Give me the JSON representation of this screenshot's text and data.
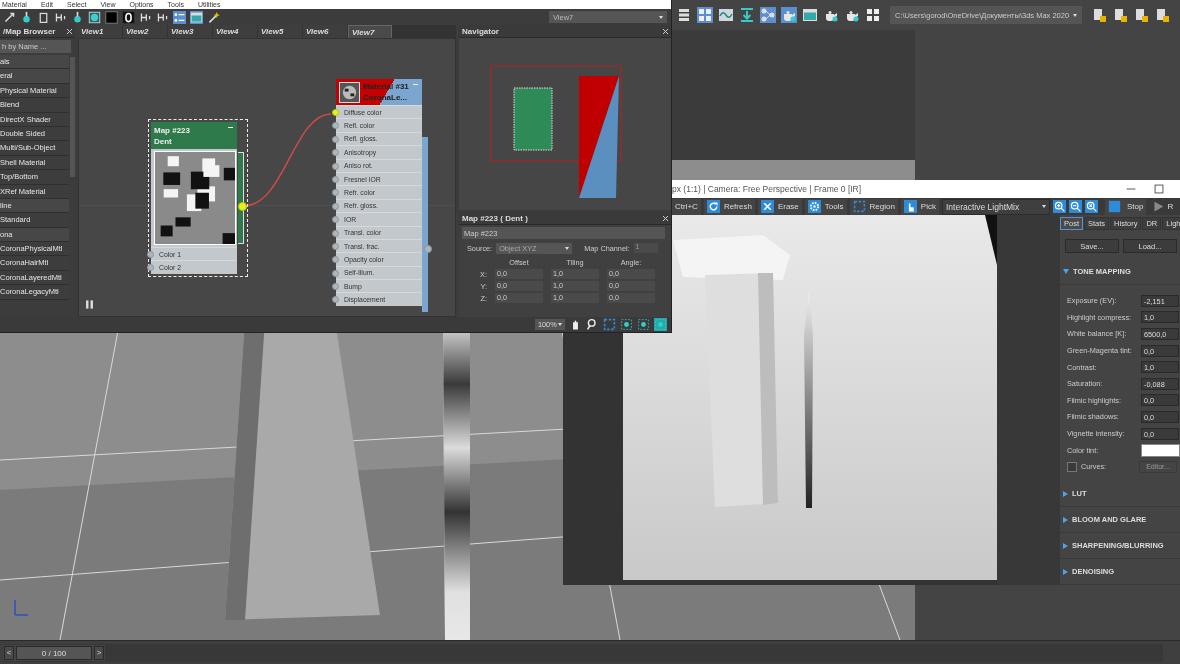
{
  "slate_editor": {
    "menu": [
      "Material",
      "Edit",
      "Select",
      "View",
      "Options",
      "Tools",
      "Utilities"
    ],
    "view_selector": "View7",
    "browser": {
      "title": "/Map Browser",
      "search_placeholder": "h by Name ...",
      "items": [
        {
          "kind": "group",
          "label": "als"
        },
        {
          "kind": "group",
          "label": "eral"
        },
        {
          "kind": "item",
          "label": "Physical Material"
        },
        {
          "kind": "item",
          "label": "Blend"
        },
        {
          "kind": "item",
          "label": "DirectX Shader"
        },
        {
          "kind": "item",
          "label": "Double Sided"
        },
        {
          "kind": "item",
          "label": "Multi/Sub-Object"
        },
        {
          "kind": "item",
          "label": "Shell Material"
        },
        {
          "kind": "item",
          "label": "Top/Bottom"
        },
        {
          "kind": "item",
          "label": "XRef Material"
        },
        {
          "kind": "group",
          "label": "line"
        },
        {
          "kind": "item",
          "label": "Standard"
        },
        {
          "kind": "group",
          "label": "ona"
        },
        {
          "kind": "item",
          "label": "CoronaPhysicalMtl"
        },
        {
          "kind": "item",
          "label": "CoronaHairMtl"
        },
        {
          "kind": "item",
          "label": "CoronaLayeredMtl"
        },
        {
          "kind": "item",
          "label": "CoronaLegacyMtl"
        }
      ]
    },
    "view_tabs": [
      {
        "label": "View1",
        "selected": false
      },
      {
        "label": "View2",
        "selected": false
      },
      {
        "label": "View3",
        "selected": false
      },
      {
        "label": "View4",
        "selected": false
      },
      {
        "label": "View5",
        "selected": false
      },
      {
        "label": "View6",
        "selected": false
      },
      {
        "label": "View7",
        "selected": true
      }
    ],
    "nodes": [
      {
        "kind": "map",
        "title": "Map #223",
        "subtitle": "Dent",
        "selected": true,
        "slots": [
          {
            "label": "Color 1",
            "connected": false
          },
          {
            "label": "Color 2",
            "connected": false
          }
        ]
      },
      {
        "kind": "material",
        "title": "Material #31",
        "subtitle": "CoronaLe...",
        "selected": false,
        "slots": [
          {
            "label": "Diffuse color",
            "connected": true
          },
          {
            "label": "Refl. color",
            "connected": false
          },
          {
            "label": "Refl. gloss.",
            "connected": false
          },
          {
            "label": "Anisotropy",
            "connected": false
          },
          {
            "label": "Aniso rot.",
            "connected": false
          },
          {
            "label": "Fresnel IOR",
            "connected": false
          },
          {
            "label": "Refr. color",
            "connected": false
          },
          {
            "label": "Refr. gloss.",
            "connected": false
          },
          {
            "label": "IOR",
            "connected": false
          },
          {
            "label": "Transl. color",
            "connected": false
          },
          {
            "label": "Transl. frac.",
            "connected": false
          },
          {
            "label": "Opacity color",
            "connected": false
          },
          {
            "label": "Self-Illum.",
            "connected": false
          },
          {
            "label": "Bump",
            "connected": false
          },
          {
            "label": "Displacement",
            "connected": false
          }
        ]
      }
    ],
    "navigator": {
      "title": "Navigator"
    },
    "parameters": {
      "title": "Map #223  ( Dent )",
      "name": "Map #223",
      "source_label": "Source:",
      "source": "Object XYZ",
      "channel_label": "Map Channel:",
      "channel": "1",
      "channel_disabled": true,
      "columns": [
        "Offset",
        "Tiling",
        "Angle:"
      ],
      "rows": [
        {
          "axis": "X:",
          "values": [
            "0,0",
            "1,0",
            "0,0"
          ]
        },
        {
          "axis": "Y:",
          "values": [
            "0,0",
            "1,0",
            "0,0"
          ]
        },
        {
          "axis": "Z:",
          "values": [
            "0,0",
            "1,0",
            "0,0"
          ]
        }
      ]
    },
    "zoom": "100%"
  },
  "main_toolbar": {
    "path": "C:\\Users\\gorod\\OneDrive\\Документы\\3ds Max 2020"
  },
  "frame_buffer": {
    "title": "px (1:1) | Camera: Free Perspective | Frame 0 [IR]",
    "tools": [
      {
        "kind": "text",
        "label": "Ctrl+C"
      },
      {
        "kind": "refresh",
        "label": "Refresh"
      },
      {
        "kind": "erase",
        "label": "Erase"
      },
      {
        "kind": "gear",
        "label": "Tools"
      },
      {
        "kind": "region",
        "label": "Region"
      },
      {
        "kind": "hand",
        "label": "Pick"
      }
    ],
    "lightmix": "Interactive LightMix",
    "stop": "Stop",
    "render": "R",
    "tabs": [
      {
        "label": "Post",
        "selected": true
      },
      {
        "label": "Stats",
        "selected": false
      },
      {
        "label": "History",
        "selected": false
      },
      {
        "label": "DR",
        "selected": false
      },
      {
        "label": "Ligh",
        "selected": false
      }
    ],
    "buttons": [
      "Save...",
      "Load..."
    ],
    "sections": [
      {
        "title": "TONE MAPPING",
        "expanded": true,
        "params": [
          {
            "kind": "number",
            "label": "Exposure (EV):",
            "value": "-2,151"
          },
          {
            "kind": "number",
            "label": "Highlight compress:",
            "value": "1,0"
          },
          {
            "kind": "number",
            "label": "White balance [K]:",
            "value": "6500,0"
          },
          {
            "kind": "number",
            "label": "Green-Magenta tint:",
            "value": "0,0"
          },
          {
            "kind": "number",
            "label": "Contrast:",
            "value": "1,0"
          },
          {
            "kind": "number",
            "label": "Saturation:",
            "value": "-0,088"
          },
          {
            "kind": "number",
            "label": "Filmic highlights:",
            "value": "0,0"
          },
          {
            "kind": "number",
            "label": "Filmic shadows:",
            "value": "0,0"
          },
          {
            "kind": "number",
            "label": "Vignette intensity:",
            "value": "0,0"
          },
          {
            "kind": "color",
            "label": "Color tint:",
            "color": "#ffffff"
          }
        ],
        "curves": {
          "label": "Curves:",
          "checked": false,
          "button": "Editor...",
          "disabled": true
        }
      },
      {
        "title": "LUT",
        "expanded": false
      },
      {
        "title": "BLOOM AND GLARE",
        "expanded": false
      },
      {
        "title": "SHARPENING/BLURRING",
        "expanded": false
      },
      {
        "title": "DENOISING",
        "expanded": false
      }
    ]
  },
  "timeline": {
    "position": "0 / 100",
    "prev": "<",
    "next": ">",
    "level": 0
  }
}
